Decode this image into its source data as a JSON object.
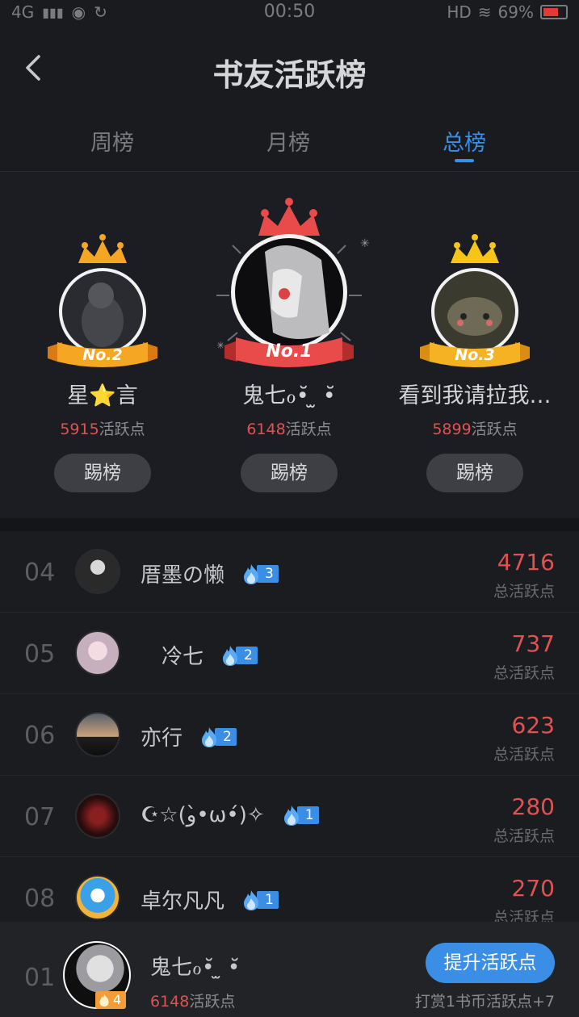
{
  "status_bar": {
    "network": "4G",
    "time": "00:50",
    "hd": "HD",
    "battery": "69%"
  },
  "header": {
    "title": "书友活跃榜"
  },
  "tabs": [
    {
      "label": "周榜"
    },
    {
      "label": "月榜"
    },
    {
      "label": "总榜",
      "active": true
    }
  ],
  "podium": {
    "first": {
      "rank_label": "No.1",
      "name": "鬼七ℴ•̆ ̫ •̆",
      "points": "6148",
      "points_suffix": "活跃点",
      "kick_label": "踢榜"
    },
    "second": {
      "rank_label": "No.2",
      "name": "星⭐言",
      "points": "5915",
      "points_suffix": "活跃点",
      "kick_label": "踢榜"
    },
    "third": {
      "rank_label": "No.3",
      "name": "看到我请拉我…",
      "points": "5899",
      "points_suffix": "活跃点",
      "kick_label": "踢榜"
    }
  },
  "ranking": [
    {
      "rank": "04",
      "name": "厝墨の懒",
      "level": "3",
      "score": "4716",
      "score_label": "总活跃点"
    },
    {
      "rank": "05",
      "name": "　冷七",
      "level": "2",
      "score": "737",
      "score_label": "总活跃点"
    },
    {
      "rank": "06",
      "name": "亦行",
      "level": "2",
      "score": "623",
      "score_label": "总活跃点"
    },
    {
      "rank": "07",
      "name": "☪☆(و•̀ω•́)✧",
      "level": "1",
      "score": "280",
      "score_label": "总活跃点"
    },
    {
      "rank": "08",
      "name": "卓尔凡凡",
      "level": "1",
      "score": "270",
      "score_label": "总活跃点"
    }
  ],
  "my_rank": {
    "rank": "01",
    "name": "鬼七ℴ•̆ ̫ •̆",
    "level": "4",
    "points": "6148",
    "points_suffix": "活跃点",
    "boost_label": "提升活跃点",
    "reward_text": "打赏1书币活跃点+7"
  },
  "colors": {
    "accent": "#3a8ee6",
    "score": "#e05252",
    "gold": "#f5a623",
    "red_ribbon": "#e94b4b"
  }
}
